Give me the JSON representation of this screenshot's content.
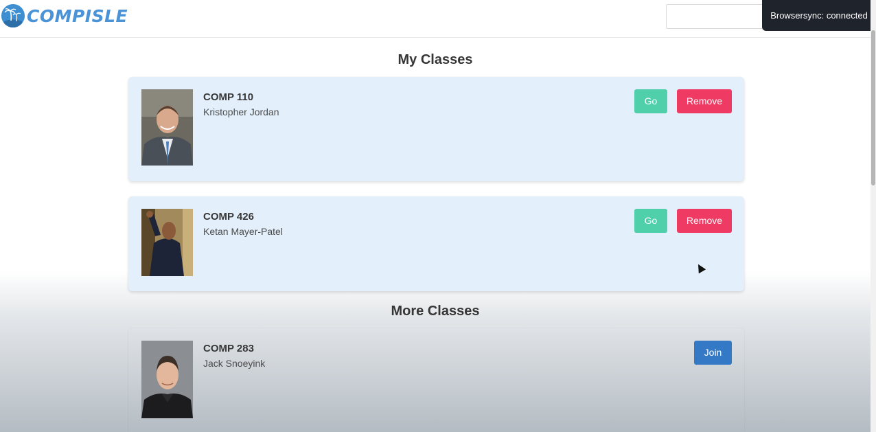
{
  "header": {
    "logo_text": "COMPISLE",
    "search_value": "",
    "browsersync_status": "Browsersync: connected"
  },
  "my_classes": {
    "title": "My Classes",
    "items": [
      {
        "code": "COMP 110",
        "instructor": "Kristopher Jordan",
        "go_label": "Go",
        "remove_label": "Remove"
      },
      {
        "code": "COMP 426",
        "instructor": "Ketan Mayer-Patel",
        "go_label": "Go",
        "remove_label": "Remove"
      }
    ]
  },
  "more_classes": {
    "title": "More Classes",
    "items": [
      {
        "code": "COMP 283",
        "instructor": "Jack Snoeyink",
        "join_label": "Join"
      }
    ]
  },
  "colors": {
    "go": "#4fcfaa",
    "remove": "#ef3b63",
    "join": "#3379c5",
    "card_bg": "#e3f0fc"
  }
}
